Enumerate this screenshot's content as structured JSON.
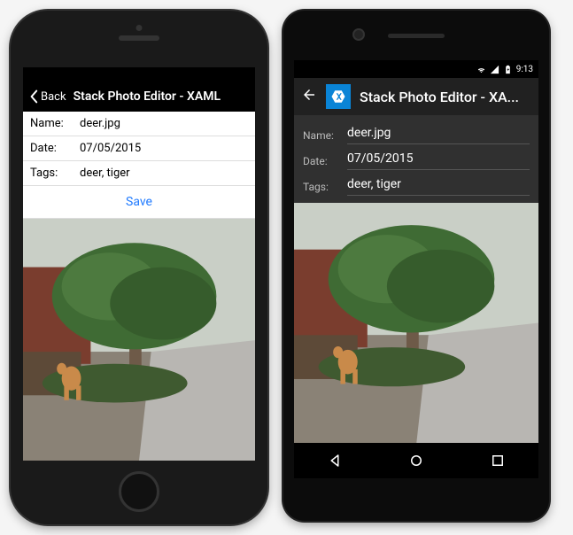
{
  "ios": {
    "nav": {
      "back_label": "Back",
      "title": "Stack Photo Editor - XAML"
    },
    "form": {
      "name_label": "Name:",
      "name_value": "deer.jpg",
      "date_label": "Date:",
      "date_value": "07/05/2015",
      "tags_label": "Tags:",
      "tags_value": "deer, tiger",
      "save_label": "Save"
    }
  },
  "android": {
    "status": {
      "time": "9:13"
    },
    "abar": {
      "title": "Stack Photo Editor - XA..."
    },
    "form": {
      "name_label": "Name:",
      "name_value": "deer.jpg",
      "date_label": "Date:",
      "date_value": "07/05/2015",
      "tags_label": "Tags:",
      "tags_value": "deer, tiger"
    }
  }
}
